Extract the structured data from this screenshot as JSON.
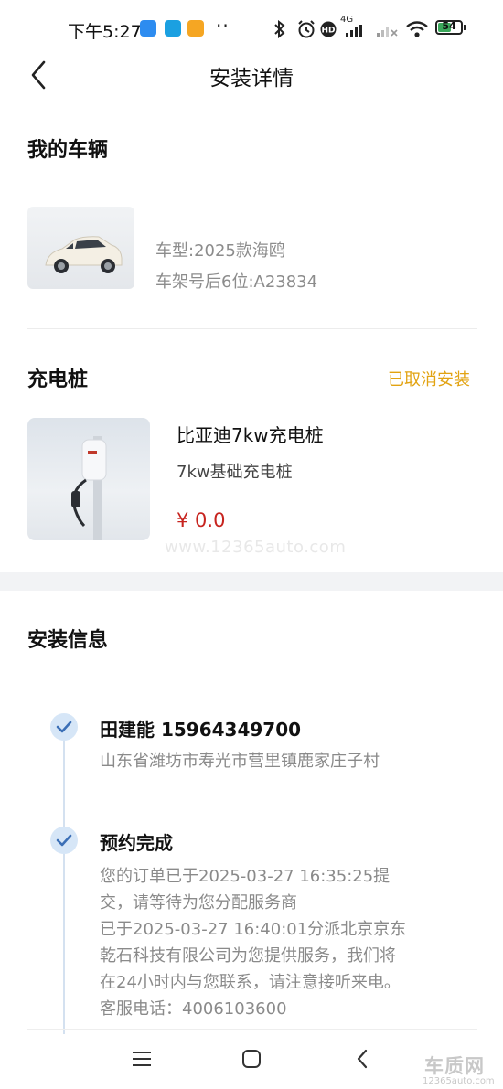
{
  "status_bar": {
    "time": "下午5:27",
    "dots": "··",
    "network": "4G",
    "battery": "54"
  },
  "header": {
    "title": "安装详情"
  },
  "vehicle": {
    "section_title": "我的车辆",
    "model_label": "车型:2025款海鸥",
    "vin_label": "车架号后6位:A23834"
  },
  "charger": {
    "section_title": "充电桩",
    "status": "已取消安装",
    "name": "比亚迪7kw充电桩",
    "description": "7kw基础充电桩",
    "price": "¥ 0.0"
  },
  "watermark": "www.12365auto.com",
  "install_info": {
    "section_title": "安装信息",
    "steps": [
      {
        "title": "田建能 15964349700",
        "lines": [
          "山东省潍坊市寿光市营里镇鹿家庄子村"
        ]
      },
      {
        "title": "预约完成",
        "lines": [
          "您的订单已于2025-03-27 16:35:25提",
          "交，请等待为您分配服务商",
          "已于2025-03-27 16:40:01分派北京京东",
          "乾石科技有限公司为您提供服务，我们将",
          "在24小时内与您联系，请注意接听来电。",
          "客服电话：4006103600"
        ]
      }
    ]
  },
  "logo": {
    "text": "车质网",
    "url_text": "12365auto.com"
  },
  "colors": {
    "accent_status": "#e2a312",
    "price": "#c7241f",
    "timeline_check": "#3b6fb6"
  }
}
